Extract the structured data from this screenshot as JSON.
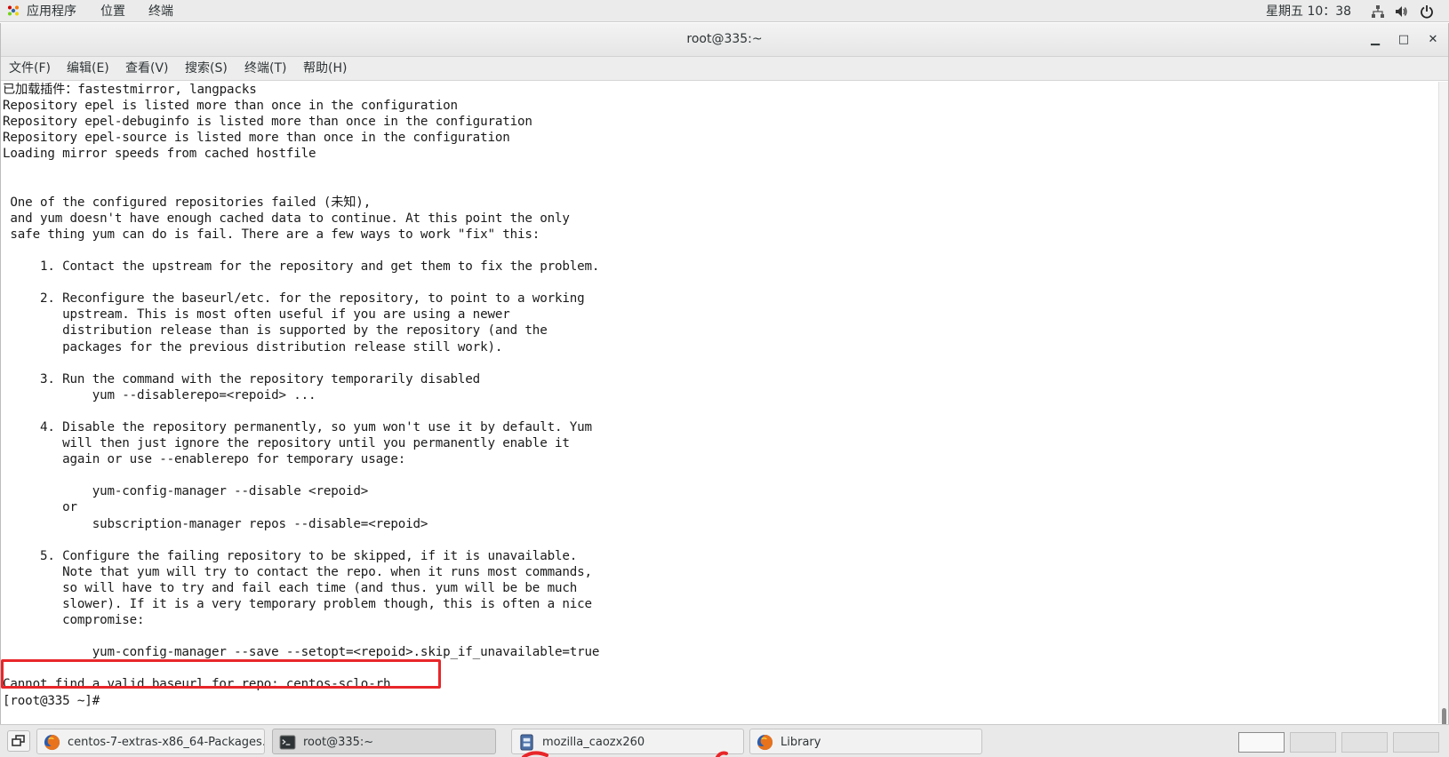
{
  "top_panel": {
    "applications_label": "应用程序",
    "places_label": "位置",
    "terminal_label": "终端",
    "clock": "星期五 10：38",
    "icons": [
      "apps-logo-icon",
      "network-icon",
      "volume-icon",
      "power-icon"
    ]
  },
  "window": {
    "title": "root@335:~",
    "minimize_glyph": "▁",
    "maximize_glyph": "□",
    "close_glyph": "✕"
  },
  "menubar": {
    "items": [
      "文件(F)",
      "编辑(E)",
      "查看(V)",
      "搜索(S)",
      "终端(T)",
      "帮助(H)"
    ]
  },
  "terminal": {
    "lines": [
      "已加载插件：fastestmirror, langpacks",
      "Repository epel is listed more than once in the configuration",
      "Repository epel-debuginfo is listed more than once in the configuration",
      "Repository epel-source is listed more than once in the configuration",
      "Loading mirror speeds from cached hostfile",
      "",
      "",
      " One of the configured repositories failed (未知),",
      " and yum doesn't have enough cached data to continue. At this point the only",
      " safe thing yum can do is fail. There are a few ways to work \"fix\" this:",
      "",
      "     1. Contact the upstream for the repository and get them to fix the problem.",
      "",
      "     2. Reconfigure the baseurl/etc. for the repository, to point to a working",
      "        upstream. This is most often useful if you are using a newer",
      "        distribution release than is supported by the repository (and the",
      "        packages for the previous distribution release still work).",
      "",
      "     3. Run the command with the repository temporarily disabled",
      "            yum --disablerepo=<repoid> ...",
      "",
      "     4. Disable the repository permanently, so yum won't use it by default. Yum",
      "        will then just ignore the repository until you permanently enable it",
      "        again or use --enablerepo for temporary usage:",
      "",
      "            yum-config-manager --disable <repoid>",
      "        or",
      "            subscription-manager repos --disable=<repoid>",
      "",
      "     5. Configure the failing repository to be skipped, if it is unavailable.",
      "        Note that yum will try to contact the repo. when it runs most commands,",
      "        so will have to try and fail each time (and thus. yum will be be much",
      "        slower). If it is a very temporary problem though, this is often a nice",
      "        compromise:",
      "",
      "            yum-config-manager --save --setopt=<repoid>.skip_if_unavailable=true",
      "",
      "Cannot find a valid baseurl for repo: centos-sclo-rh",
      "[root@335 ~]# "
    ],
    "highlight_color": "#e8262a"
  },
  "taskbar": {
    "tasks": [
      {
        "label": "centos-7-extras-x86_64-Packages...",
        "icon": "firefox-icon",
        "active": false
      },
      {
        "label": "root@335:~",
        "icon": "terminal-icon",
        "active": true
      },
      {
        "label": "mozilla_caozx260",
        "icon": "file-manager-icon",
        "active": false
      },
      {
        "label": "Library",
        "icon": "firefox-icon",
        "active": false
      }
    ],
    "workspace_count": 4,
    "active_workspace": 1
  }
}
